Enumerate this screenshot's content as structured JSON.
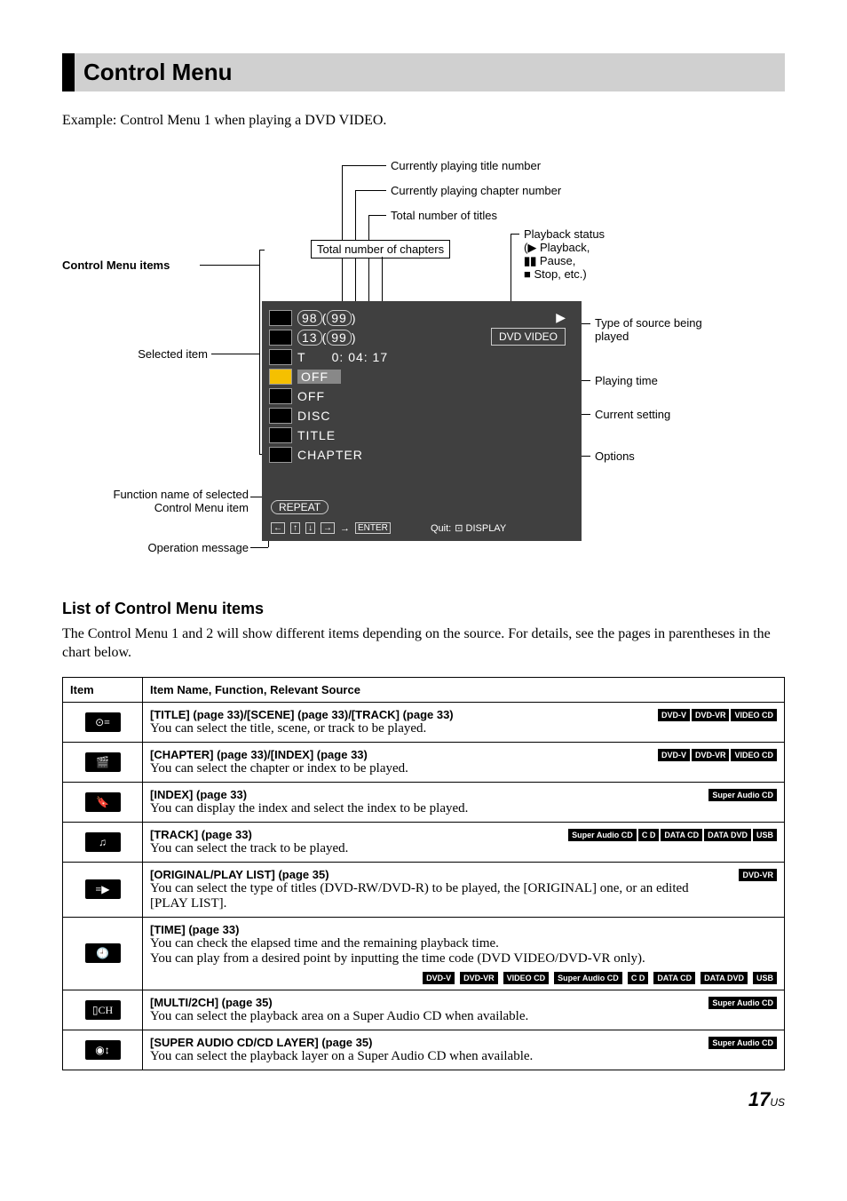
{
  "heading": "Control Menu",
  "example": "Example: Control Menu 1 when playing a DVD VIDEO.",
  "diagram": {
    "cm_items": "Control Menu items",
    "selected_item": "Selected item",
    "func_name1": "Function name of selected",
    "func_name2": "Control Menu item",
    "op_msg": "Operation message",
    "curr_title": "Currently playing title number",
    "curr_chapter": "Currently playing chapter number",
    "total_titles": "Total number of titles",
    "total_chapters": "Total number of chapters",
    "playback_status1": "Playback status",
    "playback_status2a": "(",
    "playback_status2b": " Playback,",
    "playback_status3a": " Pause,",
    "playback_status4a": " Stop, etc.)",
    "type_source1": "Type of source being",
    "type_source2": "played",
    "playing_time": "Playing time",
    "current_setting": "Current setting",
    "options": "Options",
    "osd": {
      "row1a": "98",
      "row1b": "99",
      "row2a": "13",
      "row2b": "99",
      "row3": "T      0: 04: 17",
      "row4": "OFF",
      "row5": "OFF",
      "row6": "DISC",
      "row7": "TITLE",
      "row8": "CHAPTER",
      "source": "DVD VIDEO",
      "repeat": "REPEAT",
      "enter": "ENTER",
      "quit": "Quit:",
      "display": "DISPLAY",
      "play": "▶"
    }
  },
  "subheading": "List of Control Menu items",
  "intro": "The Control Menu 1 and 2 will show different items depending on the source. For details, see the pages in parentheses in the chart below.",
  "table": {
    "header_item": "Item",
    "header_desc": "Item Name, Function, Relevant Source",
    "rows": [
      {
        "glyph": "⊙≡",
        "title": "[TITLE] (page 33)/[SCENE] (page 33)/[TRACK] (page 33)",
        "desc": "You can select the title, scene, or track to be played.",
        "badges": [
          "DVD-V",
          "DVD-VR",
          "VIDEO CD"
        ]
      },
      {
        "glyph": "🎬",
        "title": "[CHAPTER] (page 33)/[INDEX] (page 33)",
        "desc": "You can select the chapter or index to be played.",
        "badges": [
          "DVD-V",
          "DVD-VR",
          "VIDEO CD"
        ]
      },
      {
        "glyph": "🔖",
        "title": "[INDEX] (page 33)",
        "desc": "You can display the index and select the index to be played.",
        "badges": [
          "Super Audio CD"
        ]
      },
      {
        "glyph": "♫",
        "title": "[TRACK] (page 33)",
        "desc": "You can select the track to be played.",
        "badges": [
          "Super Audio CD",
          "C D",
          "DATA CD",
          "DATA DVD",
          "USB"
        ]
      },
      {
        "glyph": "≡▶",
        "title": "[ORIGINAL/PLAY LIST] (page 35)",
        "desc": "You can select the type of titles (DVD-RW/DVD-R) to be played, the [ORIGINAL] one, or an edited [PLAY LIST].",
        "badges": [
          "DVD-VR"
        ]
      },
      {
        "glyph": "🕘",
        "title": "[TIME] (page 33)",
        "desc1": "You can check the elapsed time and the remaining playback time.",
        "desc2": "You can play from a desired point by inputting the time code (DVD VIDEO/DVD-VR only).",
        "badges": [
          "DVD-V",
          "DVD-VR",
          "VIDEO CD",
          "Super Audio CD",
          "C D",
          "DATA CD",
          "DATA DVD",
          "USB"
        ]
      },
      {
        "glyph": "▯CH",
        "title": "[MULTI/2CH] (page 35)",
        "desc": "You can select the playback area on a Super Audio CD when available.",
        "badges": [
          "Super Audio CD"
        ]
      },
      {
        "glyph": "◉↕",
        "title": "[SUPER AUDIO CD/CD LAYER] (page 35)",
        "desc": "You can select the playback layer on a Super Audio CD when available.",
        "badges": [
          "Super Audio CD"
        ]
      }
    ]
  },
  "footer": {
    "num": "17",
    "suf": "US"
  }
}
